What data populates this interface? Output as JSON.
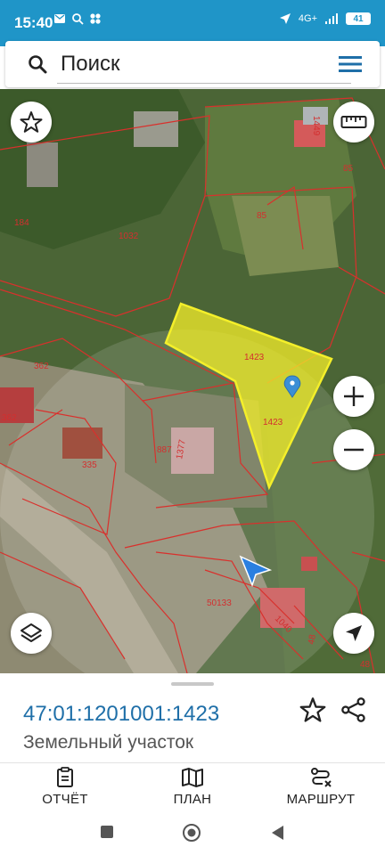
{
  "status_bar": {
    "time": "15:40",
    "network": "4G+",
    "battery": "41"
  },
  "search": {
    "placeholder": "Поиск"
  },
  "map": {
    "parcel_labels": [
      "184",
      "1032",
      "85",
      "85",
      "1449",
      "362",
      "362",
      "1423",
      "1423",
      "887",
      "1377",
      "335",
      "50133",
      "1040",
      "48",
      "48"
    ],
    "selected_color": "#f4ef2a",
    "boundary_color": "#d9302c"
  },
  "parcel_info": {
    "cadastral_number": "47:01:1201001:1423",
    "land_type": "Земельный участок"
  },
  "actions": [
    {
      "label": "ОТЧЁТ",
      "icon": "report-icon"
    },
    {
      "label": "ПЛАН",
      "icon": "map-plan-icon"
    },
    {
      "label": "МАРШРУТ",
      "icon": "route-icon"
    }
  ],
  "colors": {
    "accent": "#1f95c8",
    "cadastral_number": "#1f6fa8"
  }
}
